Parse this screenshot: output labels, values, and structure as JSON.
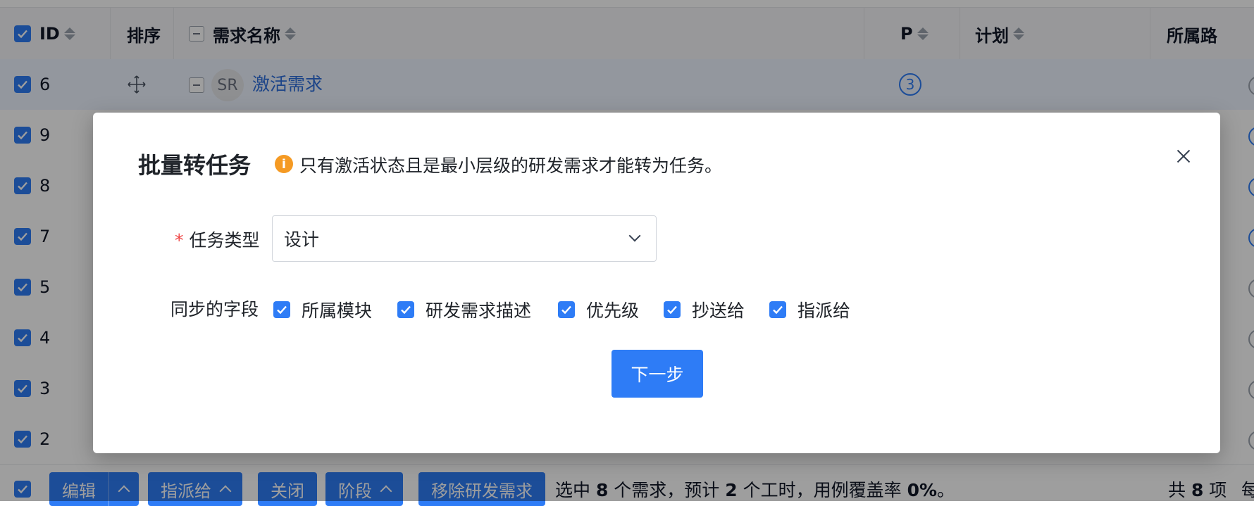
{
  "colors": {
    "accent": "#2e7cf6",
    "warning": "#f59a23",
    "required": "#ef4444"
  },
  "table": {
    "headers": {
      "id": "ID",
      "order": "排序",
      "name": "需求名称",
      "priority": "P",
      "plan": "计划",
      "path": "所属路"
    },
    "rows": [
      {
        "id": "6",
        "avatar": "SR",
        "name": "激活需求",
        "priority": "3"
      },
      {
        "id": "9"
      },
      {
        "id": "8"
      },
      {
        "id": "7"
      },
      {
        "id": "5"
      },
      {
        "id": "4"
      },
      {
        "id": "3"
      },
      {
        "id": "2"
      }
    ]
  },
  "footer": {
    "buttons": {
      "edit": "编辑",
      "assign": "指派给",
      "close": "关闭",
      "stage": "阶段",
      "remove": "移除研发需求"
    },
    "summary": {
      "prefix": "选中 ",
      "count": "8",
      "mid1": " 个需求，预计 ",
      "hours": "2",
      "mid2": " 个工时，用例覆盖率 ",
      "coverage": "0%",
      "suffix": "。"
    },
    "total": {
      "prefix": "共 ",
      "count": "8",
      "suffix": " 项",
      "tail": "每"
    }
  },
  "dialog": {
    "title": "批量转任务",
    "tip": "只有激活状态且是最小层级的研发需求才能转为任务。",
    "task_type_label": "任务类型",
    "task_type_value": "设计",
    "sync_label": "同步的字段",
    "sync_fields": [
      "所属模块",
      "研发需求描述",
      "优先级",
      "抄送给",
      "指派给"
    ],
    "next_button": "下一步"
  }
}
